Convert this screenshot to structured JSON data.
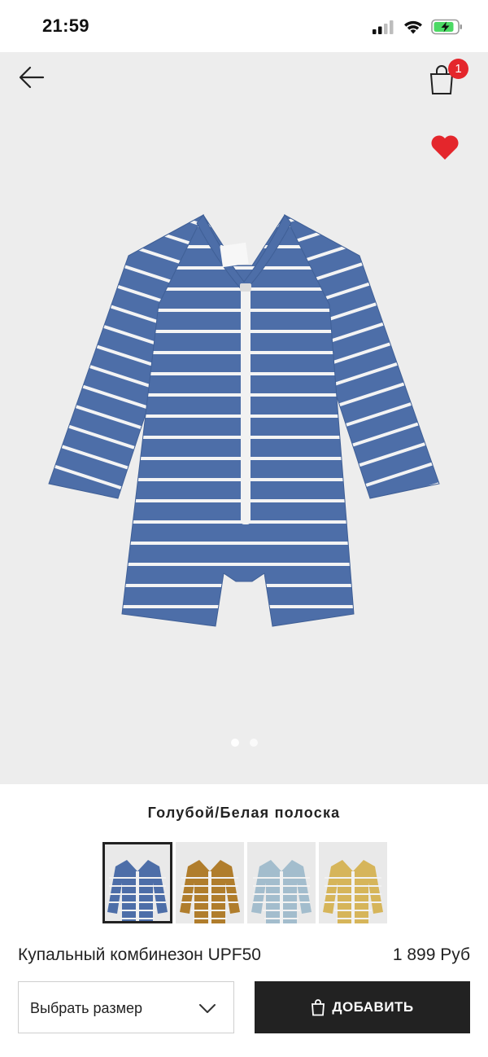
{
  "status_bar": {
    "time": "21:59",
    "icons": [
      "cellular-signal-icon",
      "wifi-icon",
      "battery-charging-icon"
    ]
  },
  "header": {
    "back_icon": "arrow-left-icon",
    "bag_icon": "shopping-bag-icon",
    "bag_count": "1",
    "favorite_icon": "heart-icon"
  },
  "gallery": {
    "image": "striped-baby-swimsuit-photo",
    "page_count": 2,
    "active_page": 1
  },
  "product": {
    "color_name": "Голубой/Белая полоска",
    "name": "Купальный комбинезон UPF50",
    "price": "1 899 Руб"
  },
  "swatches": [
    {
      "name": "blue-white-stripe",
      "color": "#4d6ea8",
      "selected": true
    },
    {
      "name": "mustard-white-stripe",
      "color": "#b07d2c",
      "selected": false
    },
    {
      "name": "lightblue-white-stripe",
      "color": "#a3bdcd",
      "selected": false
    },
    {
      "name": "yellow-white-stripe",
      "color": "#d6b55a",
      "selected": false
    }
  ],
  "actions": {
    "size_label": "Выбрать размер",
    "add_label": "ДОБАВИТЬ"
  },
  "colors": {
    "badge": "#e4262c",
    "heart": "#e4262c",
    "button_bg": "#222222",
    "gallery_bg": "#ededed",
    "garment_blue": "#4d6ea8"
  }
}
